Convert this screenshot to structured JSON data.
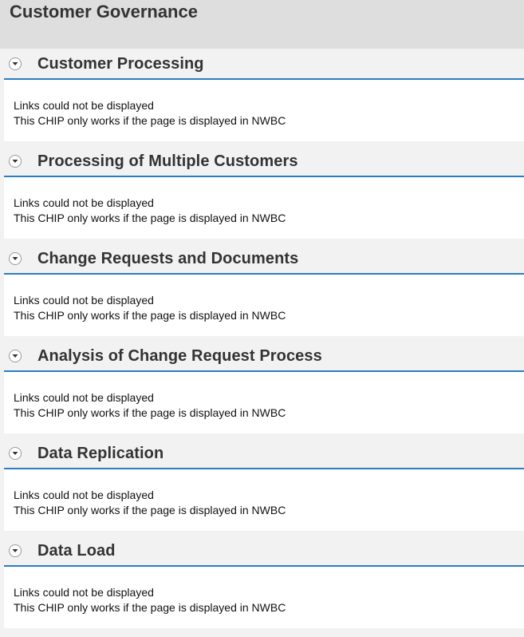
{
  "page": {
    "title": "Customer Governance"
  },
  "sections": [
    {
      "title": "Customer Processing",
      "message_line1": "Links could not be displayed",
      "message_line2": "This CHIP only works if the page is displayed in NWBC"
    },
    {
      "title": "Processing of Multiple Customers",
      "message_line1": "Links could not be displayed",
      "message_line2": "This CHIP only works if the page is displayed in NWBC"
    },
    {
      "title": "Change Requests and Documents",
      "message_line1": "Links could not be displayed",
      "message_line2": "This CHIP only works if the page is displayed in NWBC"
    },
    {
      "title": "Analysis of Change Request Process",
      "message_line1": "Links could not be displayed",
      "message_line2": "This CHIP only works if the page is displayed in NWBC"
    },
    {
      "title": "Data Replication",
      "message_line1": "Links could not be displayed",
      "message_line2": "This CHIP only works if the page is displayed in NWBC"
    },
    {
      "title": "Data Load",
      "message_line1": "Links could not be displayed",
      "message_line2": "This CHIP only works if the page is displayed in NWBC"
    }
  ],
  "icons": {
    "toggle": "chevron-down-icon"
  },
  "colors": {
    "accent": "#2c7dc0",
    "header_bg": "#dedede",
    "section_bg": "#f2f2f2",
    "body_bg": "#ffffff"
  }
}
